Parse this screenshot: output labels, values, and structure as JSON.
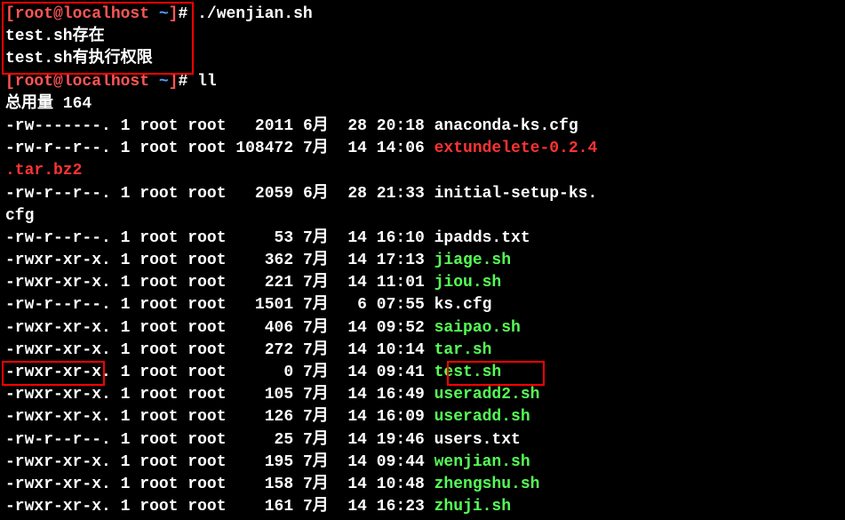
{
  "prompt": {
    "user": "root",
    "host": "localhost",
    "path": "~",
    "symbol": "#"
  },
  "cmd1": "./wenjian.sh",
  "output1_line1": "test.sh存在",
  "output1_line2": "test.sh有执行权限",
  "cmd2": "ll",
  "total_line": "总用量 164",
  "files": [
    {
      "perms": "-rw-------.",
      "links": "1",
      "owner": "root",
      "group": "root",
      "size": "2011",
      "month": "6月",
      "day": "28",
      "time": "20:18",
      "name": "anaconda-ks.cfg",
      "color": "white"
    },
    {
      "perms": "-rw-r--r--.",
      "links": "1",
      "owner": "root",
      "group": "root",
      "size": "108472",
      "month": "7月",
      "day": "14",
      "time": "14:06",
      "name": "extundelete-0.2.4.tar.bz2",
      "color": "red",
      "wrap": true
    },
    {
      "perms": "-rw-r--r--.",
      "links": "1",
      "owner": "root",
      "group": "root",
      "size": "2059",
      "month": "6月",
      "day": "28",
      "time": "21:33",
      "name": "initial-setup-ks.cfg",
      "color": "white",
      "wrap": true
    },
    {
      "perms": "-rw-r--r--.",
      "links": "1",
      "owner": "root",
      "group": "root",
      "size": "53",
      "month": "7月",
      "day": "14",
      "time": "16:10",
      "name": "ipadds.txt",
      "color": "white"
    },
    {
      "perms": "-rwxr-xr-x.",
      "links": "1",
      "owner": "root",
      "group": "root",
      "size": "362",
      "month": "7月",
      "day": "14",
      "time": "17:13",
      "name": "jiage.sh",
      "color": "green"
    },
    {
      "perms": "-rwxr-xr-x.",
      "links": "1",
      "owner": "root",
      "group": "root",
      "size": "221",
      "month": "7月",
      "day": "14",
      "time": "11:01",
      "name": "jiou.sh",
      "color": "green"
    },
    {
      "perms": "-rw-r--r--.",
      "links": "1",
      "owner": "root",
      "group": "root",
      "size": "1501",
      "month": "7月",
      "day": "6",
      "time": "07:55",
      "name": "ks.cfg",
      "color": "white"
    },
    {
      "perms": "-rwxr-xr-x.",
      "links": "1",
      "owner": "root",
      "group": "root",
      "size": "406",
      "month": "7月",
      "day": "14",
      "time": "09:52",
      "name": "saipao.sh",
      "color": "green"
    },
    {
      "perms": "-rwxr-xr-x.",
      "links": "1",
      "owner": "root",
      "group": "root",
      "size": "272",
      "month": "7月",
      "day": "14",
      "time": "10:14",
      "name": "tar.sh",
      "color": "green"
    },
    {
      "perms": "-rwxr-xr-x.",
      "links": "1",
      "owner": "root",
      "group": "root",
      "size": "0",
      "month": "7月",
      "day": "14",
      "time": "09:41",
      "name": "test.sh",
      "color": "green"
    },
    {
      "perms": "-rwxr-xr-x.",
      "links": "1",
      "owner": "root",
      "group": "root",
      "size": "105",
      "month": "7月",
      "day": "14",
      "time": "16:49",
      "name": "useradd2.sh",
      "color": "green"
    },
    {
      "perms": "-rwxr-xr-x.",
      "links": "1",
      "owner": "root",
      "group": "root",
      "size": "126",
      "month": "7月",
      "day": "14",
      "time": "16:09",
      "name": "useradd.sh",
      "color": "green"
    },
    {
      "perms": "-rw-r--r--.",
      "links": "1",
      "owner": "root",
      "group": "root",
      "size": "25",
      "month": "7月",
      "day": "14",
      "time": "19:46",
      "name": "users.txt",
      "color": "white"
    },
    {
      "perms": "-rwxr-xr-x.",
      "links": "1",
      "owner": "root",
      "group": "root",
      "size": "195",
      "month": "7月",
      "day": "14",
      "time": "09:44",
      "name": "wenjian.sh",
      "color": "green"
    },
    {
      "perms": "-rwxr-xr-x.",
      "links": "1",
      "owner": "root",
      "group": "root",
      "size": "158",
      "month": "7月",
      "day": "14",
      "time": "10:48",
      "name": "zhengshu.sh",
      "color": "green"
    },
    {
      "perms": "-rwxr-xr-x.",
      "links": "1",
      "owner": "root",
      "group": "root",
      "size": "161",
      "month": "7月",
      "day": "14",
      "time": "16:23",
      "name": "zhuji.sh",
      "color": "green"
    }
  ]
}
